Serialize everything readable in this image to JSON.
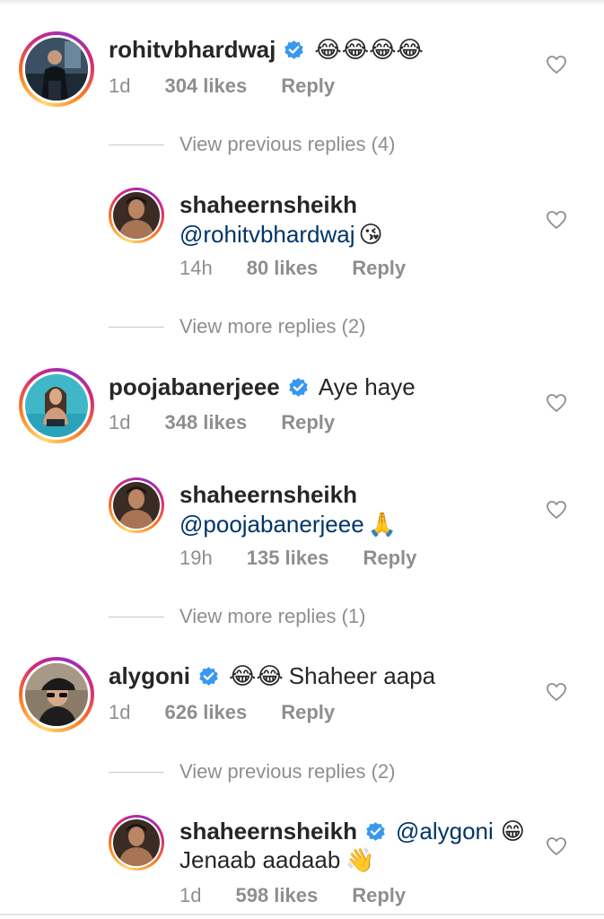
{
  "comments": [
    {
      "username": "rohitvbhardwaj",
      "verified": true,
      "text": "😂😂😂😂",
      "time": "1d",
      "likes": "304 likes",
      "reply": "Reply",
      "avatar_icon": "man-standing-photo"
    },
    {
      "username": "poojabanerjeee",
      "verified": true,
      "text": "Aye haye",
      "time": "1d",
      "likes": "348 likes",
      "reply": "Reply",
      "avatar_icon": "woman-pool-photo"
    },
    {
      "username": "alygoni",
      "verified": true,
      "emoji": "😂😂",
      "text": "Shaheer aapa",
      "time": "1d",
      "likes": "626 likes",
      "reply": "Reply",
      "avatar_icon": "man-cap-photo"
    }
  ],
  "view_replies": [
    "View previous replies (4)",
    "View more replies (2)",
    "View more replies (1)",
    "View previous replies (2)"
  ],
  "replies": [
    {
      "username": "shaheernsheikh",
      "mention": "@rohitvbhardwaj",
      "emoji": "😘",
      "time": "14h",
      "likes": "80 likes",
      "reply": "Reply",
      "avatar_icon": "shirtless-man-photo"
    },
    {
      "username": "shaheernsheikh",
      "mention": "@poojabanerjeee",
      "emoji": "🙏",
      "time": "19h",
      "likes": "135 likes",
      "reply": "Reply",
      "avatar_icon": "shirtless-man-photo"
    },
    {
      "username": "shaheernsheikh",
      "verified": true,
      "mention": "@alygoni",
      "emoji": "😁",
      "text2": "Jenaab aadaab",
      "emoji2": "👋",
      "time": "1d",
      "likes": "598 likes",
      "reply": "Reply",
      "avatar_icon": "shirtless-man-photo"
    }
  ],
  "colors": {
    "text": "#262626",
    "secondary": "#8e8e8e",
    "mention": "#003569",
    "verified": "#3897f0",
    "ring_start": "#feda75",
    "ring_end": "#962fbf"
  },
  "icons": {
    "like": "heart-outline-icon",
    "verified": "verified-badge-icon"
  }
}
